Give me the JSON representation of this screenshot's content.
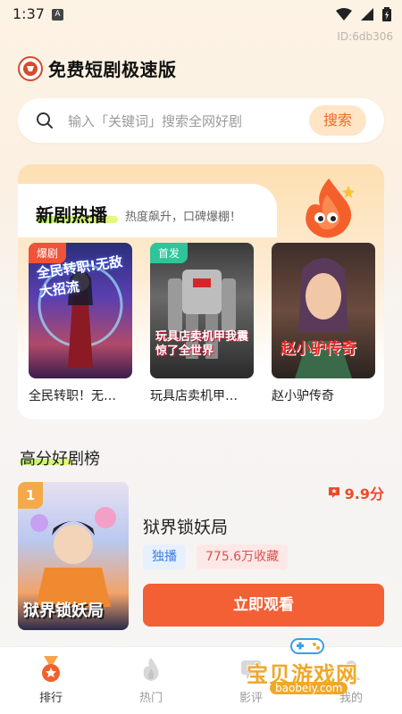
{
  "status_bar": {
    "time": "1:37",
    "notification_letter": "A"
  },
  "device_id": "ID:6db306",
  "app": {
    "title": "免费短剧极速版"
  },
  "search": {
    "placeholder": "输入「关键词」搜索全网好剧",
    "button_label": "搜索"
  },
  "hot_section": {
    "title": "新剧热播",
    "subtitle": "热度飙升，口碑爆棚！",
    "cards": [
      {
        "title": "全民转职！无…",
        "badge": "爆剧",
        "badge_color": "#f0533a",
        "poster_text": "全民转职!无敌大招流"
      },
      {
        "title": "玩具店卖机甲…",
        "badge": "首发",
        "badge_color": "#2fc49a",
        "poster_text": "玩具店卖机甲我震惊了全世界"
      },
      {
        "title": "赵小驴传奇",
        "badge": "",
        "badge_color": "",
        "poster_text": "赵小驴传奇"
      }
    ]
  },
  "rank_section": {
    "title": "高分好剧榜",
    "item": {
      "rank": "1",
      "title": "狱界锁妖局",
      "score": "9.9分",
      "tags": [
        "独播",
        "775.6万收藏"
      ],
      "watch_label": "立即观看",
      "poster_text": "狱界锁妖局"
    }
  },
  "bottom_nav": [
    {
      "label": "排行",
      "icon": "medal-icon",
      "active": true
    },
    {
      "label": "热门",
      "icon": "flame-icon",
      "active": false
    },
    {
      "label": "影评",
      "icon": "review-icon",
      "active": false
    },
    {
      "label": "我的",
      "icon": "profile-icon",
      "active": false
    }
  ],
  "watermark": {
    "text": "宝贝游戏网",
    "url": "baobeiy.com"
  },
  "colors": {
    "accent": "#f36036",
    "badge_hot": "#f0533a",
    "badge_new": "#2fc49a",
    "score": "#ee4a2a",
    "search_button_bg": "#fde5c6"
  }
}
